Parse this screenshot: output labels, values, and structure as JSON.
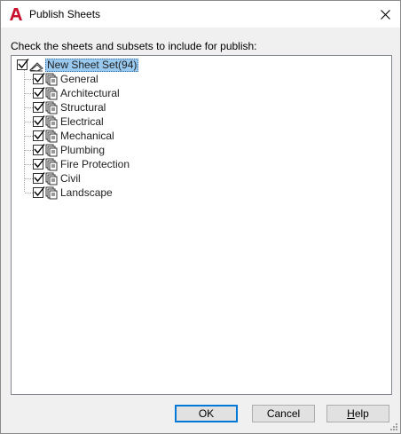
{
  "window": {
    "title": "Publish Sheets",
    "app_icon": "autocad-a-icon",
    "close_icon": "close-icon"
  },
  "instruction": "Check the sheets and subsets to include for publish:",
  "tree": {
    "root": {
      "label": "New Sheet Set(94)",
      "checked": true,
      "icon": "sheet-set-icon",
      "selected": true
    },
    "items": [
      {
        "label": "General",
        "checked": true,
        "icon": "sheet-subset-icon"
      },
      {
        "label": "Architectural",
        "checked": true,
        "icon": "sheet-subset-icon"
      },
      {
        "label": "Structural",
        "checked": true,
        "icon": "sheet-subset-icon"
      },
      {
        "label": "Electrical",
        "checked": true,
        "icon": "sheet-subset-icon"
      },
      {
        "label": "Mechanical",
        "checked": true,
        "icon": "sheet-subset-icon"
      },
      {
        "label": "Plumbing",
        "checked": true,
        "icon": "sheet-subset-icon"
      },
      {
        "label": "Fire Protection",
        "checked": true,
        "icon": "sheet-subset-icon"
      },
      {
        "label": "Civil",
        "checked": true,
        "icon": "sheet-subset-icon"
      },
      {
        "label": "Landscape",
        "checked": true,
        "icon": "sheet-subset-icon"
      }
    ]
  },
  "buttons": {
    "ok": "OK",
    "cancel": "Cancel",
    "help_mnemonic": "H",
    "help_rest": "elp"
  },
  "colors": {
    "selection": "#99c9ef",
    "default_button_border": "#0078d7",
    "app_icon_red": "#c8102e"
  }
}
